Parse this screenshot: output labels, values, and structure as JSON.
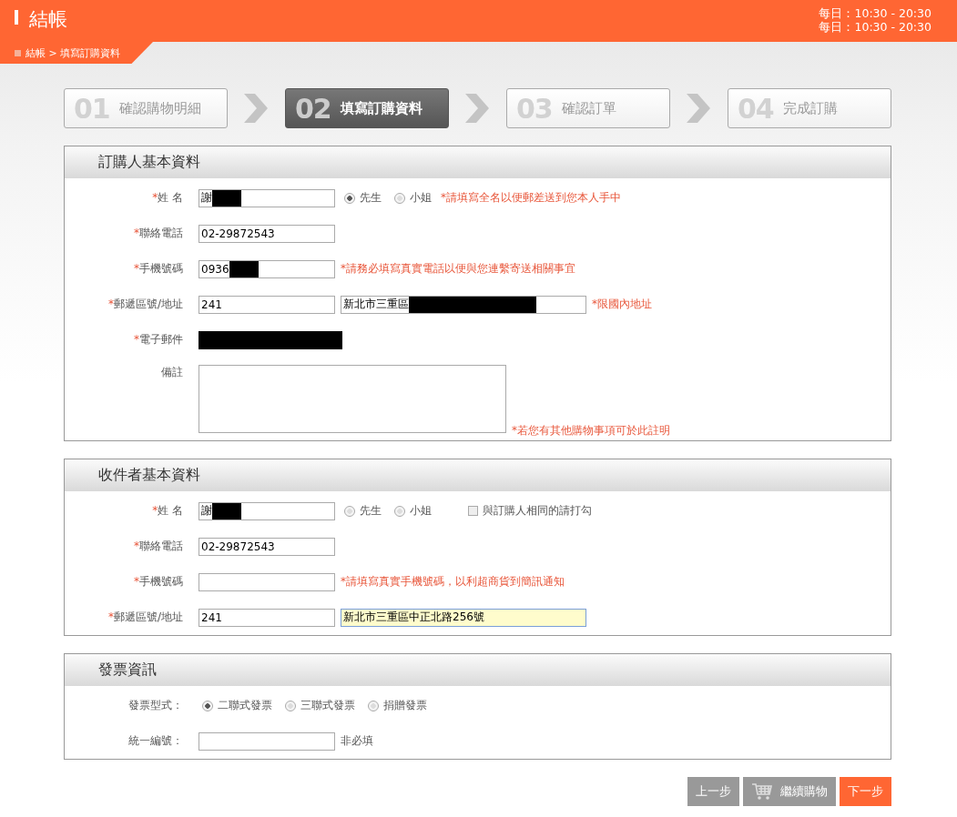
{
  "header": {
    "title": "結帳",
    "breadcrumb": "結帳 > 填寫訂購資料",
    "hours": [
      "每日：10:30 - 20:30",
      "每日：10:30 - 20:30"
    ]
  },
  "steps": [
    {
      "number": "01",
      "label": "確認購物明細",
      "selected": false
    },
    {
      "number": "02",
      "label": "填寫訂購資料",
      "selected": true
    },
    {
      "number": "03",
      "label": "確認訂單",
      "selected": false
    },
    {
      "number": "04",
      "label": "完成訂購",
      "selected": false
    }
  ],
  "sections": [
    {
      "title": "訂購人基本資料",
      "rows": [
        {
          "kind": "input",
          "marker": "*",
          "label": "姓 名",
          "fields": [
            {
              "kind": "short",
              "value": "謝",
              "redacted": true
            }
          ],
          "options": [
            {
              "label": "先生",
              "selected": true
            },
            {
              "label": "小姐",
              "selected": false
            }
          ],
          "notes": [
            {
              "kind": "warning",
              "text": "*請填寫全名以便郵差送到您本人手中"
            }
          ]
        },
        {
          "kind": "input",
          "marker": "*",
          "label": "聯絡電話",
          "fields": [
            {
              "kind": "short",
              "value": "02-29872543"
            }
          ]
        },
        {
          "kind": "input",
          "marker": "*",
          "label": "手機號碼",
          "fields": [
            {
              "kind": "short",
              "value": "0936",
              "redacted": true
            }
          ],
          "notes": [
            {
              "kind": "warning",
              "text": "*請務必填寫真實電話以便與您連繫寄送相關事宜"
            }
          ]
        },
        {
          "kind": "input",
          "marker": "*",
          "label": "郵遞區號/地址",
          "fields": [
            {
              "kind": "short",
              "value": "241"
            },
            {
              "kind": "long",
              "value": "新北市三重區",
              "redacted": true
            }
          ],
          "notes": [
            {
              "kind": "warning",
              "text": "*限國內地址"
            }
          ]
        },
        {
          "kind": "redacted",
          "marker": "*",
          "label": "電子郵件"
        },
        {
          "kind": "textarea",
          "label": "備註",
          "notes": [
            {
              "kind": "warning",
              "text": "*若您有其他購物事項可於此註明"
            }
          ]
        }
      ]
    },
    {
      "title": "收件者基本資料",
      "rows": [
        {
          "kind": "input",
          "marker": "*",
          "label": "姓 名",
          "fields": [
            {
              "kind": "short",
              "value": "謝",
              "redacted": true
            }
          ],
          "options": [
            {
              "label": "先生",
              "selected": false
            },
            {
              "label": "小姐",
              "selected": false
            }
          ],
          "checkbox": {
            "label": "與訂購人相同的請打勾",
            "checked": false
          }
        },
        {
          "kind": "input",
          "marker": "*",
          "label": "聯絡電話",
          "fields": [
            {
              "kind": "short",
              "value": "02-29872543"
            }
          ]
        },
        {
          "kind": "input",
          "marker": "*",
          "label": "手機號碼",
          "fields": [
            {
              "kind": "short"
            }
          ],
          "notes": [
            {
              "kind": "warning",
              "text": "*請填寫真實手機號碼，以利超商貨到簡訊通知"
            }
          ]
        },
        {
          "kind": "input",
          "marker": "*",
          "label": "郵遞區號/地址",
          "fields": [
            {
              "kind": "short",
              "value": "241"
            },
            {
              "kind": "long",
              "value": "新北市三重區中正北路256號",
              "focused": true
            }
          ]
        }
      ]
    },
    {
      "title": "發票資訊",
      "rows": [
        {
          "kind": "input",
          "label": "發票型式：",
          "options": [
            {
              "label": "二聯式發票",
              "selected": true
            },
            {
              "label": "三聯式發票",
              "selected": false
            },
            {
              "label": "捐贈發票",
              "selected": false
            }
          ]
        },
        {
          "kind": "input",
          "label": "統一編號：",
          "fields": [
            {
              "kind": "medium"
            }
          ],
          "notes": [
            {
              "kind": "plain",
              "text": "非必填"
            }
          ]
        }
      ]
    }
  ],
  "buttons": [
    {
      "kind": "secondary",
      "label": "上一步"
    },
    {
      "kind": "cart",
      "label": "繼續購物"
    },
    {
      "kind": "primary",
      "label": "下一步"
    }
  ]
}
